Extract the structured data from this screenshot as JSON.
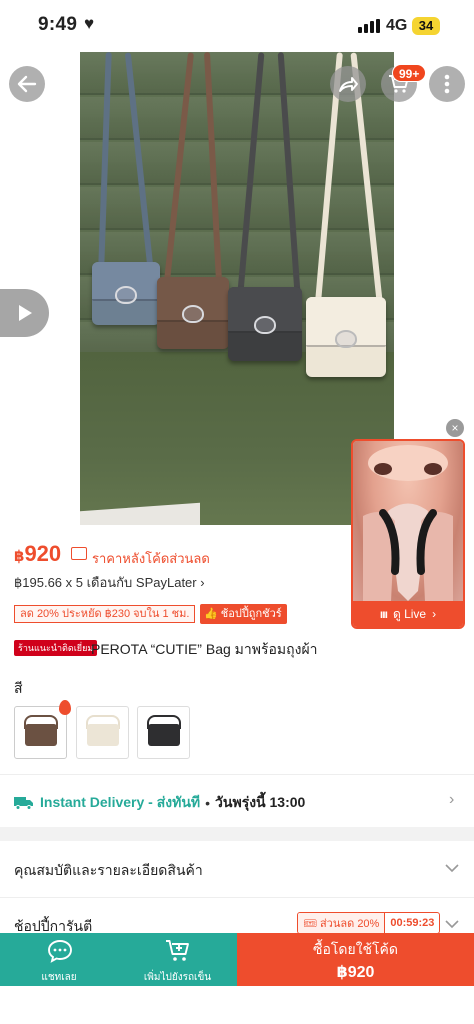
{
  "status_bar": {
    "time": "9:49",
    "heart": "♥",
    "network": "4G",
    "battery": "34"
  },
  "header": {
    "cart_badge": "99+",
    "icons": [
      "back-arrow-icon",
      "share-icon",
      "cart-icon",
      "more-icon"
    ]
  },
  "live": {
    "label": "ดู Live",
    "bars": "ııı",
    "close": "×"
  },
  "price": {
    "currency": "฿",
    "amount": "920",
    "after_code_label": "ราคาหลังโค้ดส่วนลด"
  },
  "installment": "฿195.66 x 5 เดือนกับ SPayLater",
  "promo_tag": "ลด 20% ประหยัด ฿230 จบใน 1 ชม.",
  "guarantee_tag": "ช้อปปี้ถูกชัวร์",
  "recommend_badge": "ร้านแนะนำติดเยี่ยม",
  "title": "PEROTA “CUTIE” Bag มาพร้อมถุงผ้า",
  "variant_label": "สี",
  "swatches": [
    {
      "name": "brown",
      "color": "#6b5142"
    },
    {
      "name": "cream",
      "color": "#ece5d6"
    },
    {
      "name": "black",
      "color": "#2e2e30"
    }
  ],
  "delivery": {
    "label": "Instant Delivery - ส่งทันที",
    "dot": "•",
    "when": "วันพรุ่งนี้ 13:00"
  },
  "sections": {
    "specs": "คุณสมบัติและรายละเอียดสินค้า",
    "guarantee": "ช้อปปี้การันตี"
  },
  "timer": {
    "discount": "ส่วนลด 20%",
    "countdown": "00:59:23"
  },
  "bottom_bar": {
    "chat_label": "แชทเลย",
    "cart_label": "เพิ่มไปยังรถเข็น",
    "buy_label": "ซื้อโดยใช้โค้ด",
    "buy_price": "฿920"
  },
  "colors": {
    "brand": "#ee4d2d",
    "teal": "#26aa99"
  }
}
